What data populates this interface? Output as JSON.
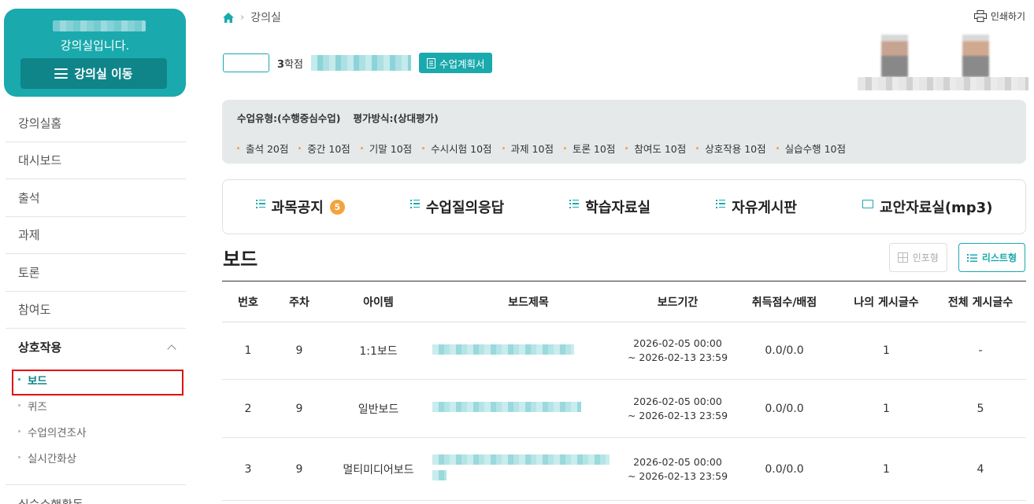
{
  "sidebar": {
    "course_subtitle": "강의실입니다.",
    "move_button": "강의실 이동",
    "menu": [
      "강의실홈",
      "대시보드",
      "출석",
      "과제",
      "토론",
      "참여도"
    ],
    "open_menu": "상호작용",
    "submenu": [
      "보드",
      "퀴즈",
      "수업의견조사",
      "실시간화상"
    ],
    "active_sub": "보드",
    "last_menu": "실습수행활동"
  },
  "header": {
    "breadcrumb": "강의실",
    "print_label": "인쇄하기"
  },
  "course_info": {
    "credit_number": "3",
    "credit_label": "학점",
    "plan_button": "수업계획서"
  },
  "grading": {
    "type": "수업유형:(수행중심수업)",
    "method": "평가방식:(상대평가)",
    "items": [
      "출석 20점",
      "중간 10점",
      "기말 10점",
      "수시시험 10점",
      "과제 10점",
      "토론 10점",
      "참여도 10점",
      "상호작용 10점",
      "실습수행 10점"
    ]
  },
  "tabs": [
    {
      "label": "과목공지",
      "badge": "5",
      "icon": "list-icon"
    },
    {
      "label": "수업질의응답",
      "icon": "list-icon"
    },
    {
      "label": "학습자료실",
      "icon": "list-icon"
    },
    {
      "label": "자유게시판",
      "icon": "list-icon"
    },
    {
      "label": "교안자료실(mp3)",
      "icon": "folder-icon"
    }
  ],
  "board": {
    "title": "보드",
    "view_card": "인포형",
    "view_list": "리스트형",
    "columns": [
      "번호",
      "주차",
      "아이템",
      "보드제목",
      "보드기간",
      "취득점수/배점",
      "나의 게시글수",
      "전체 게시글수"
    ],
    "rows": [
      {
        "no": "1",
        "week": "9",
        "item": "1:1보드",
        "start": "2026-02-05 00:00",
        "end": "~ 2026-02-13 23:59",
        "score": "0.0/0.0",
        "mine": "1",
        "total": "-"
      },
      {
        "no": "2",
        "week": "9",
        "item": "일반보드",
        "start": "2026-02-05 00:00",
        "end": "~ 2026-02-13 23:59",
        "score": "0.0/0.0",
        "mine": "1",
        "total": "5"
      },
      {
        "no": "3",
        "week": "9",
        "item": "멀티미디어보드",
        "start": "2026-02-05 00:00",
        "end": "~ 2026-02-13 23:59",
        "score": "0.0/0.0",
        "mine": "1",
        "total": "4"
      }
    ]
  },
  "colors": {
    "accent": "#1aa9ad",
    "accent_dark": "#0f8589",
    "badge": "#f4a33c",
    "highlight": "#e10f0f"
  }
}
